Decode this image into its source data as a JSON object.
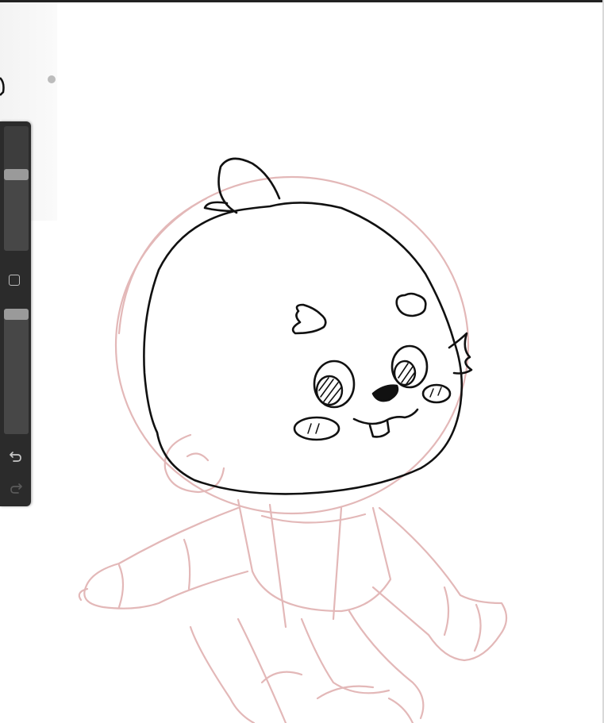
{
  "app": {
    "type": "drawing-canvas"
  },
  "sidebar": {
    "brush_size": {
      "value": 0.61
    },
    "brush_opacity": {
      "value": 0.97
    },
    "modify_button": {
      "icon": "square-icon"
    },
    "undo_button": {
      "icon": "undo-arrow-icon",
      "enabled": true
    },
    "redo_button": {
      "icon": "redo-arrow-icon",
      "enabled": false
    }
  },
  "colors": {
    "ink": "#111111",
    "sketch_guide": "#e3b8b8",
    "toolbar_bg": "#2b2b2b",
    "slider_thumb": "#9a9a9a",
    "icon_active": "#c8c8c8",
    "icon_disabled": "#5a5a5a"
  }
}
